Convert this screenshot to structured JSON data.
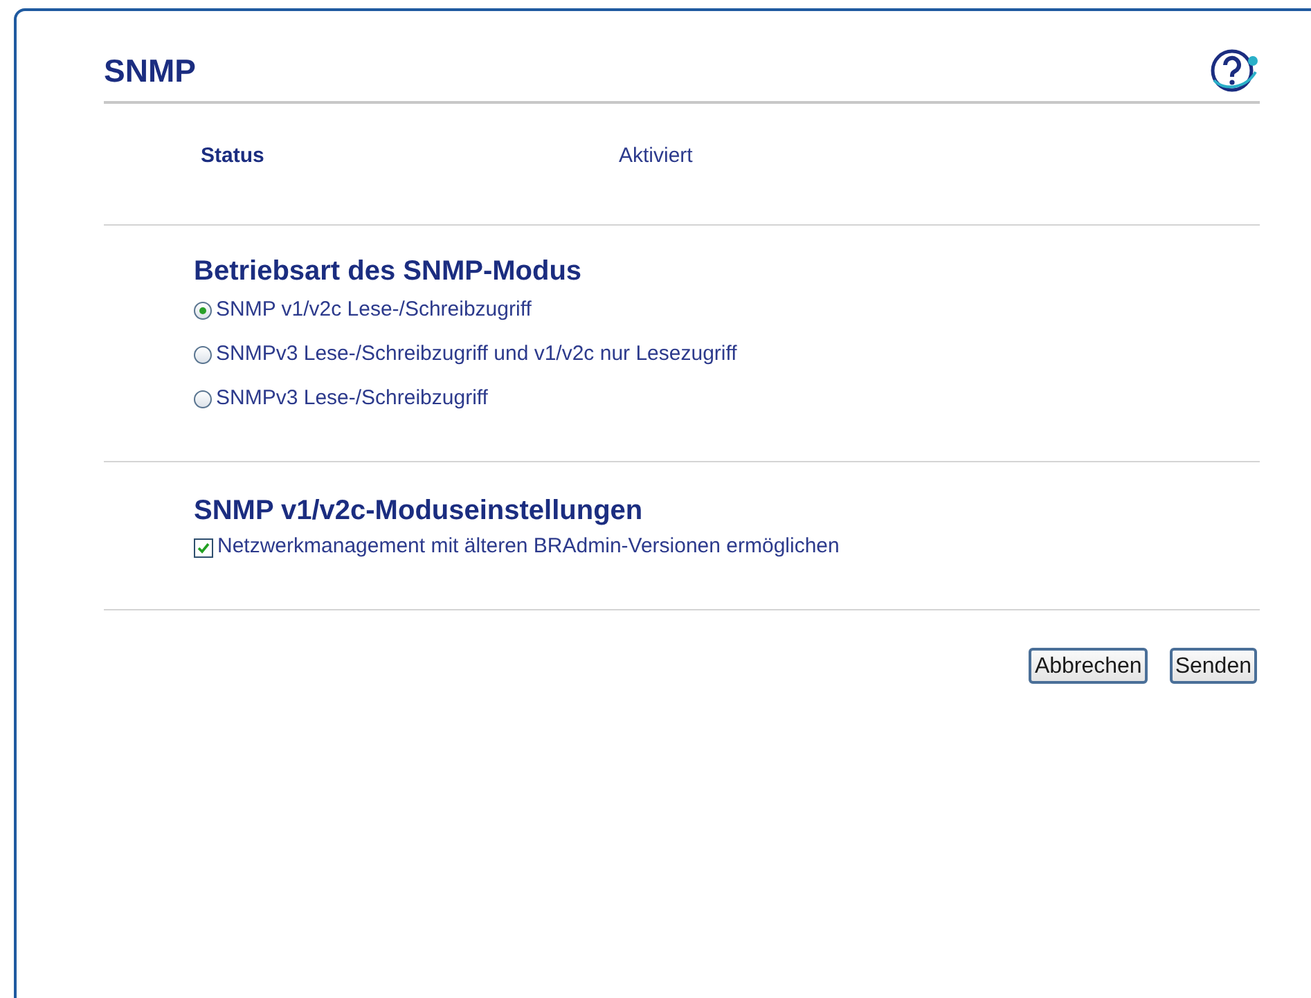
{
  "page": {
    "title": "SNMP"
  },
  "status": {
    "label": "Status",
    "value": "Aktiviert"
  },
  "mode_section": {
    "heading": "Betriebsart des SNMP-Modus",
    "options": [
      {
        "label": "SNMP v1/v2c Lese-/Schreibzugriff",
        "selected": true
      },
      {
        "label": "SNMPv3 Lese-/Schreibzugriff und v1/v2c nur Lesezugriff",
        "selected": false
      },
      {
        "label": "SNMPv3 Lese-/Schreibzugriff",
        "selected": false
      }
    ]
  },
  "settings_section": {
    "heading": "SNMP v1/v2c-Moduseinstellungen",
    "checkboxes": [
      {
        "label": "Netzwerkmanagement mit älteren BRAdmin-Versionen ermöglichen",
        "checked": true
      }
    ]
  },
  "buttons": [
    "Abbrechen",
    "Senden"
  ]
}
